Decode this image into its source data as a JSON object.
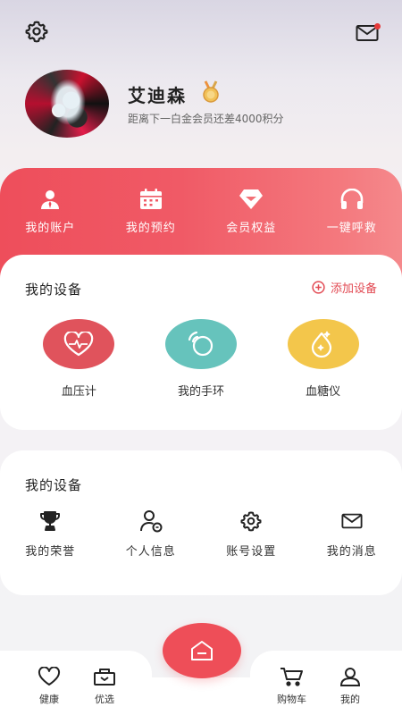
{
  "header": {
    "settings_icon": "gear-icon",
    "messages_icon": "envelope-icon",
    "has_unread": true
  },
  "profile": {
    "name": "艾迪森",
    "badge_icon": "medal-icon",
    "points_text": "距离下一白金会员还差4000积分"
  },
  "quick_actions": [
    {
      "label": "我的账户",
      "icon": "user-icon"
    },
    {
      "label": "我的预约",
      "icon": "calendar-icon"
    },
    {
      "label": "会员权益",
      "icon": "diamond-icon"
    },
    {
      "label": "一键呼救",
      "icon": "headset-icon"
    }
  ],
  "devices_card": {
    "title": "我的设备",
    "add_label": "添加设备",
    "devices": [
      {
        "label": "血压计",
        "icon": "heart-pulse-icon",
        "color": "#e0535c"
      },
      {
        "label": "我的手环",
        "icon": "band-icon",
        "color": "#66c3bc"
      },
      {
        "label": "血糖仪",
        "icon": "drop-icon",
        "color": "#f3c64b"
      }
    ]
  },
  "settings_card": {
    "title": "我的设备",
    "items": [
      {
        "label": "我的荣誉",
        "icon": "trophy-icon"
      },
      {
        "label": "个人信息",
        "icon": "person-info-icon"
      },
      {
        "label": "账号设置",
        "icon": "gear-icon"
      },
      {
        "label": "我的消息",
        "icon": "envelope-icon"
      }
    ]
  },
  "tabbar": {
    "tabs": [
      {
        "label": "健康",
        "icon": "heart-icon"
      },
      {
        "label": "优选",
        "icon": "box-icon"
      },
      {
        "label": "购物车",
        "icon": "cart-icon"
      },
      {
        "label": "我的",
        "icon": "profile-icon"
      }
    ],
    "center_icon": "home-icon"
  },
  "colors": {
    "accent": "#ee4e58",
    "teal": "#66c3bc",
    "yellow": "#f3c64b"
  }
}
